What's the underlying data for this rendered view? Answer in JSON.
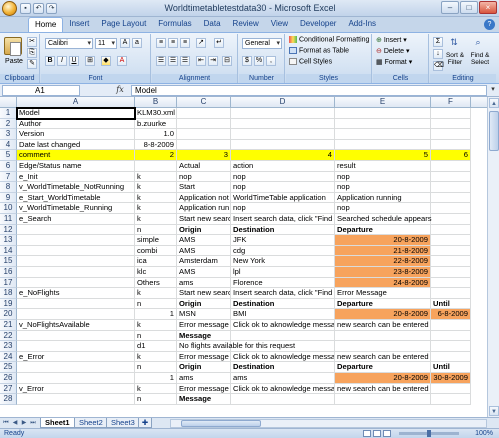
{
  "window": {
    "title": "Worldtimetabletestdata30 - Microsoft Excel",
    "qat": [
      "save-icon",
      "undo-icon",
      "redo-icon"
    ],
    "controls": [
      "minimize",
      "maximize",
      "close"
    ]
  },
  "ribbon_tabs": [
    "Home",
    "Insert",
    "Page Layout",
    "Formulas",
    "Data",
    "Review",
    "View",
    "Developer",
    "Add-Ins"
  ],
  "ribbon": {
    "clipboard": {
      "label": "Clipboard",
      "paste": "Paste"
    },
    "font": {
      "label": "Font",
      "font_name": "Calibri",
      "font_size": "11",
      "bold": "B",
      "italic": "I",
      "underline": "U"
    },
    "alignment": {
      "label": "Alignment"
    },
    "number": {
      "label": "Number",
      "format": "General",
      "currency": "$",
      "percent": "%",
      "comma": ","
    },
    "styles": {
      "label": "Styles",
      "conditional": "Conditional Formatting",
      "table": "Format as Table",
      "cell_styles": "Cell Styles"
    },
    "cells": {
      "label": "Cells",
      "insert": "Insert",
      "delete": "Delete",
      "format": "Format"
    },
    "editing": {
      "label": "Editing",
      "sum": "Σ",
      "sort": "Sort & Filter",
      "find": "Find & Select"
    }
  },
  "formula_bar": {
    "name_box": "A1",
    "fx": "fx",
    "value": "Model"
  },
  "columns": [
    "A",
    "B",
    "C",
    "D",
    "E",
    "F"
  ],
  "rows": [
    {
      "n": "1",
      "cells": [
        "Model",
        "KLM30.xml",
        "",
        "",
        "",
        ""
      ]
    },
    {
      "n": "2",
      "cells": [
        "Author",
        "b.zuurke",
        "",
        "",
        "",
        ""
      ]
    },
    {
      "n": "3",
      "cells": [
        "Version",
        "1.0",
        "",
        "",
        "",
        ""
      ]
    },
    {
      "n": "4",
      "cells": [
        "Date last changed",
        "8-8-2009",
        "",
        "",
        "",
        ""
      ]
    },
    {
      "n": "5",
      "cells": [
        "comment",
        "2",
        "3",
        "4",
        "5",
        "6"
      ]
    },
    {
      "n": "6",
      "cells": [
        "Edge/Status name",
        "",
        "Actual",
        "action",
        "result",
        ""
      ]
    },
    {
      "n": "7",
      "cells": [
        "e_Init",
        "k",
        "nop",
        "nop",
        "nop",
        ""
      ]
    },
    {
      "n": "8",
      "cells": [
        "v_WorldTimetable_NotRunning",
        "k",
        "Start",
        "nop",
        "nop",
        ""
      ]
    },
    {
      "n": "9",
      "cells": [
        "e_Start_WorldTimetable",
        "k",
        "Application not",
        "WorldTimeTable application",
        "Application running",
        ""
      ]
    },
    {
      "n": "10",
      "cells": [
        "v_WorldTimetable_Running",
        "k",
        "Application run",
        "nop",
        "nop",
        ""
      ]
    },
    {
      "n": "11",
      "cells": [
        "e_Search",
        "k",
        "Start new searc",
        "Insert search data, click \"Find",
        "Searched schedule appears",
        ""
      ]
    },
    {
      "n": "12",
      "cells": [
        "",
        "n",
        "Origin",
        "Destination",
        "Departure",
        ""
      ]
    },
    {
      "n": "13",
      "cells": [
        "",
        "simple",
        "AMS",
        "JFK",
        "20-8-2009",
        ""
      ]
    },
    {
      "n": "14",
      "cells": [
        "",
        "combi",
        "AMS",
        "cdg",
        "21-8-2009",
        ""
      ]
    },
    {
      "n": "15",
      "cells": [
        "",
        "ica",
        "Amsterdam",
        "New York",
        "22-8-2009",
        ""
      ]
    },
    {
      "n": "16",
      "cells": [
        "",
        "klc",
        "AMS",
        "lpl",
        "23-8-2009",
        ""
      ]
    },
    {
      "n": "17",
      "cells": [
        "",
        "Others",
        "ams",
        "Florence",
        "24-8-2009",
        ""
      ]
    },
    {
      "n": "18",
      "cells": [
        "e_NoFlights",
        "k",
        "Start new searc",
        "Insert search data, click \"Find",
        "Error Message",
        ""
      ]
    },
    {
      "n": "19",
      "cells": [
        "",
        "n",
        "Origin",
        "Destination",
        "Departure",
        "Until"
      ]
    },
    {
      "n": "20",
      "cells": [
        "",
        "1",
        "MSN",
        "BMI",
        "20-8-2009",
        "6-8-2009"
      ]
    },
    {
      "n": "21",
      "cells": [
        "v_NoFlightsAvailable",
        "k",
        "Error message",
        "Click ok to aknowledge messa",
        "new search can be entered",
        ""
      ]
    },
    {
      "n": "22",
      "cells": [
        "",
        "n",
        "Message",
        "",
        "",
        ""
      ]
    },
    {
      "n": "23",
      "cells": [
        "",
        "d1",
        "No flights available for this request",
        "",
        "",
        ""
      ]
    },
    {
      "n": "24",
      "cells": [
        "e_Error",
        "k",
        "Error message",
        "Click ok to aknowledge messa",
        "new search can be entered",
        ""
      ]
    },
    {
      "n": "25",
      "cells": [
        "",
        "n",
        "Origin",
        "Destination",
        "Departure",
        "Until"
      ]
    },
    {
      "n": "26",
      "cells": [
        "",
        "1",
        "ams",
        "ams",
        "20-8-2009",
        "30-8-2009"
      ]
    },
    {
      "n": "27",
      "cells": [
        "v_Error",
        "k",
        "Error message",
        "Click ok to aknowledge messa",
        "new search can be entered",
        ""
      ]
    },
    {
      "n": "28",
      "cells": [
        "",
        "n",
        "Message",
        "",
        "",
        ""
      ]
    }
  ],
  "sheets": [
    "Sheet1",
    "Sheet2",
    "Sheet3"
  ],
  "status": {
    "ready": "Ready",
    "zoom": "100%"
  },
  "colors": {
    "highlight_yellow": "#ffff00",
    "highlight_orange": "#f7a35d",
    "ribbon_blue": "#15428b"
  }
}
